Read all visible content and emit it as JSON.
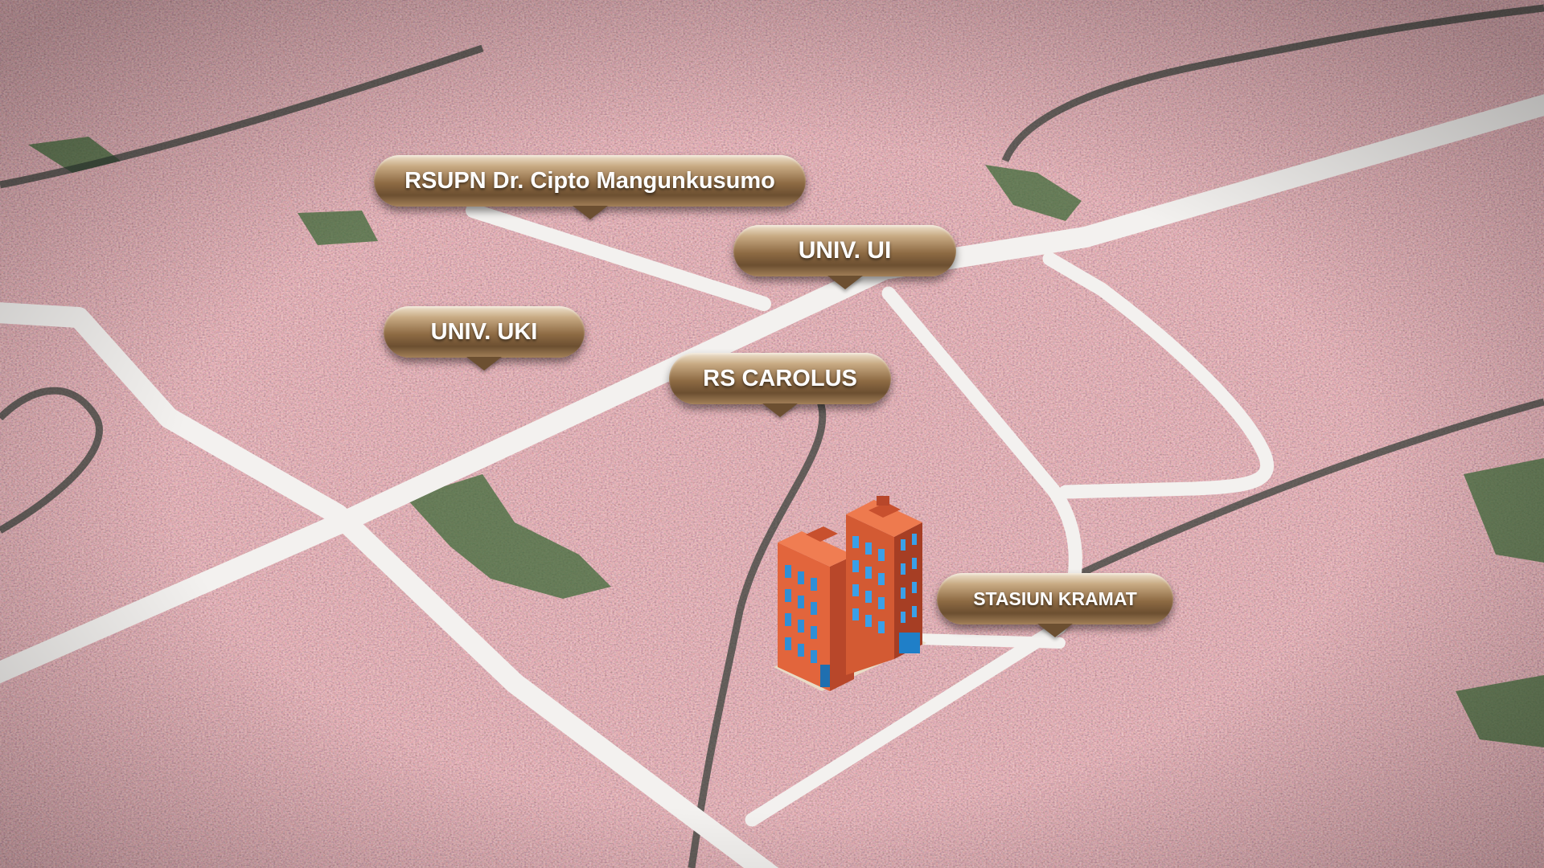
{
  "map": {
    "style": "satellite-3d-perspective",
    "road_color": "#f3f1ef",
    "landmarks": [
      {
        "id": "cipto",
        "label": "RSUPN Dr. Cipto Mangunkusumo"
      },
      {
        "id": "ui",
        "label": "UNIV. UI"
      },
      {
        "id": "uki",
        "label": "UNIV. UKI"
      },
      {
        "id": "carolus",
        "label": "RS CAROLUS"
      },
      {
        "id": "kramat",
        "label": "STASIUN KRAMAT"
      }
    ],
    "property_marker": {
      "icon": "building-icon",
      "color": "#e0603a"
    },
    "pin_color": "#a88459"
  }
}
